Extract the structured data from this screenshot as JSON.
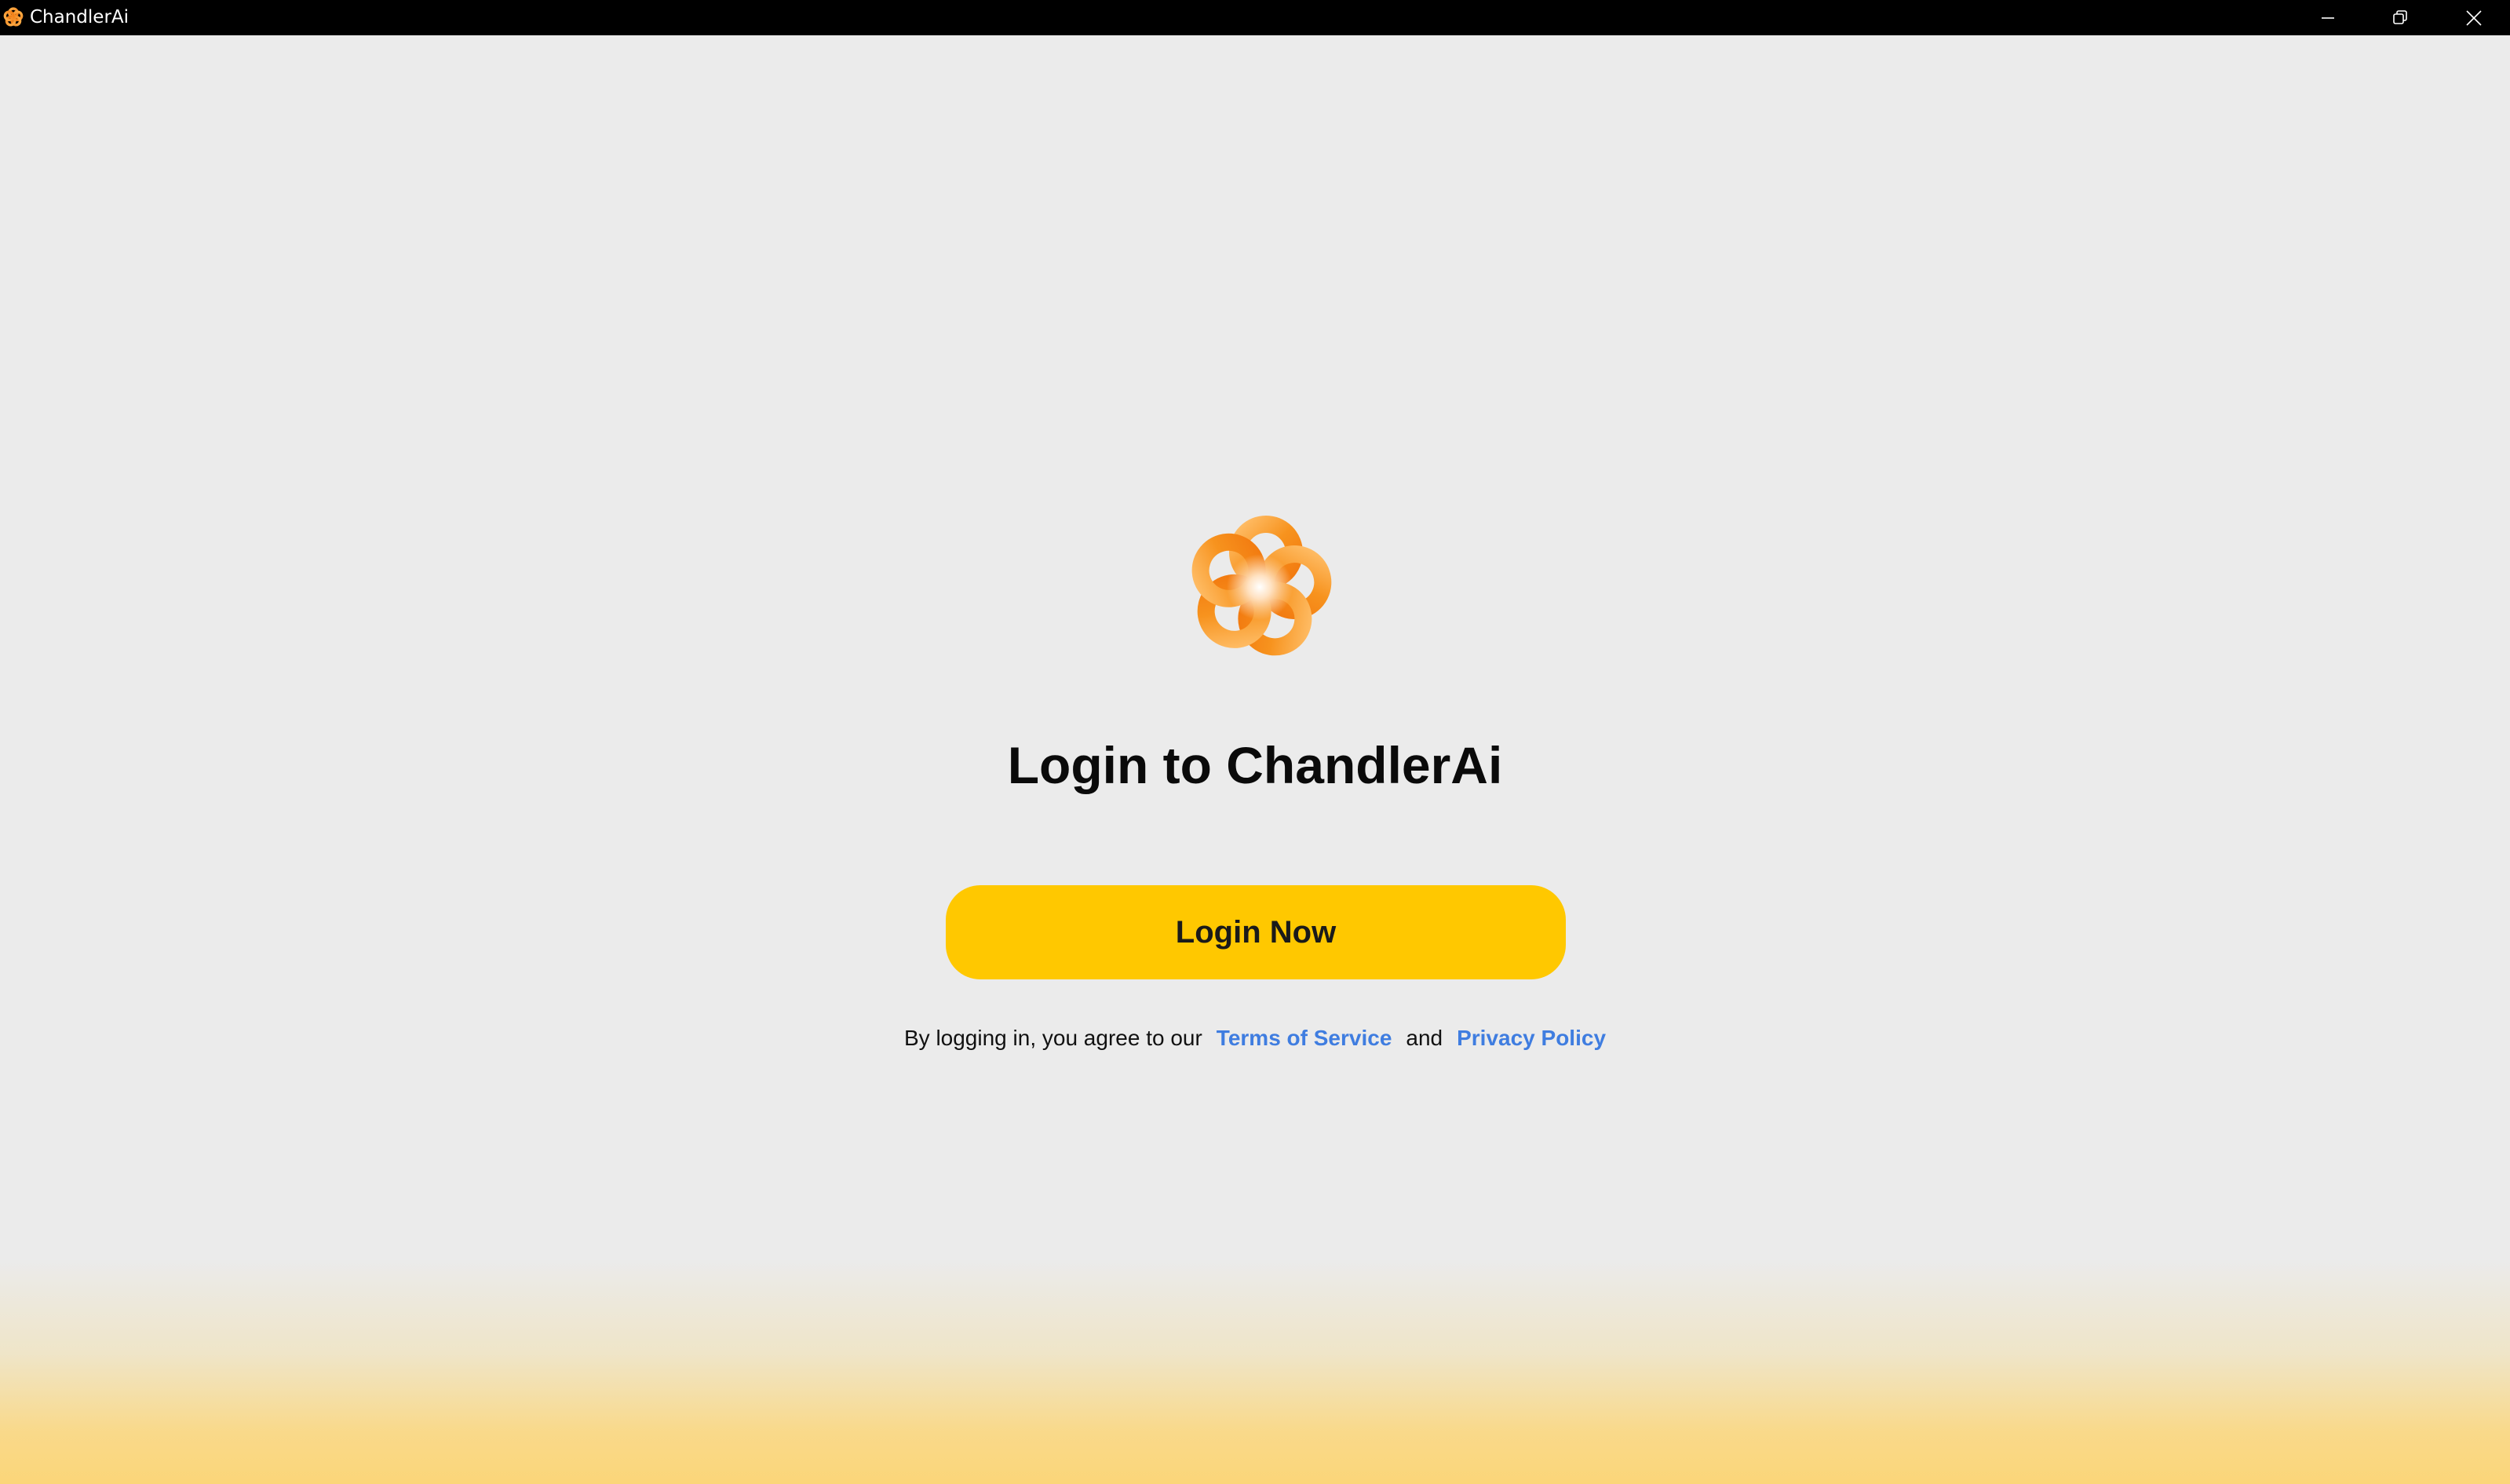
{
  "window": {
    "title": "ChandlerAi",
    "app_icon": "chandlerai-logo-icon",
    "controls": {
      "minimize_icon": "minimize-icon",
      "restore_icon": "restore-icon",
      "close_icon": "close-icon"
    }
  },
  "login": {
    "logo_icon": "chandlerai-swirl-logo",
    "title": "Login to ChandlerAi",
    "button_label": "Login Now",
    "legal": {
      "prefix": "By logging in, you agree to our",
      "terms_label": "Terms of Service",
      "conjunction": "and",
      "privacy_label": "Privacy Policy"
    }
  },
  "colors": {
    "titlebar": "#000000",
    "background": "#ebebeb",
    "accent_button": "#ffc800",
    "link": "#3f7de0",
    "bottom_gradient": "#fbd679",
    "logo_orange": "#f7931e"
  }
}
